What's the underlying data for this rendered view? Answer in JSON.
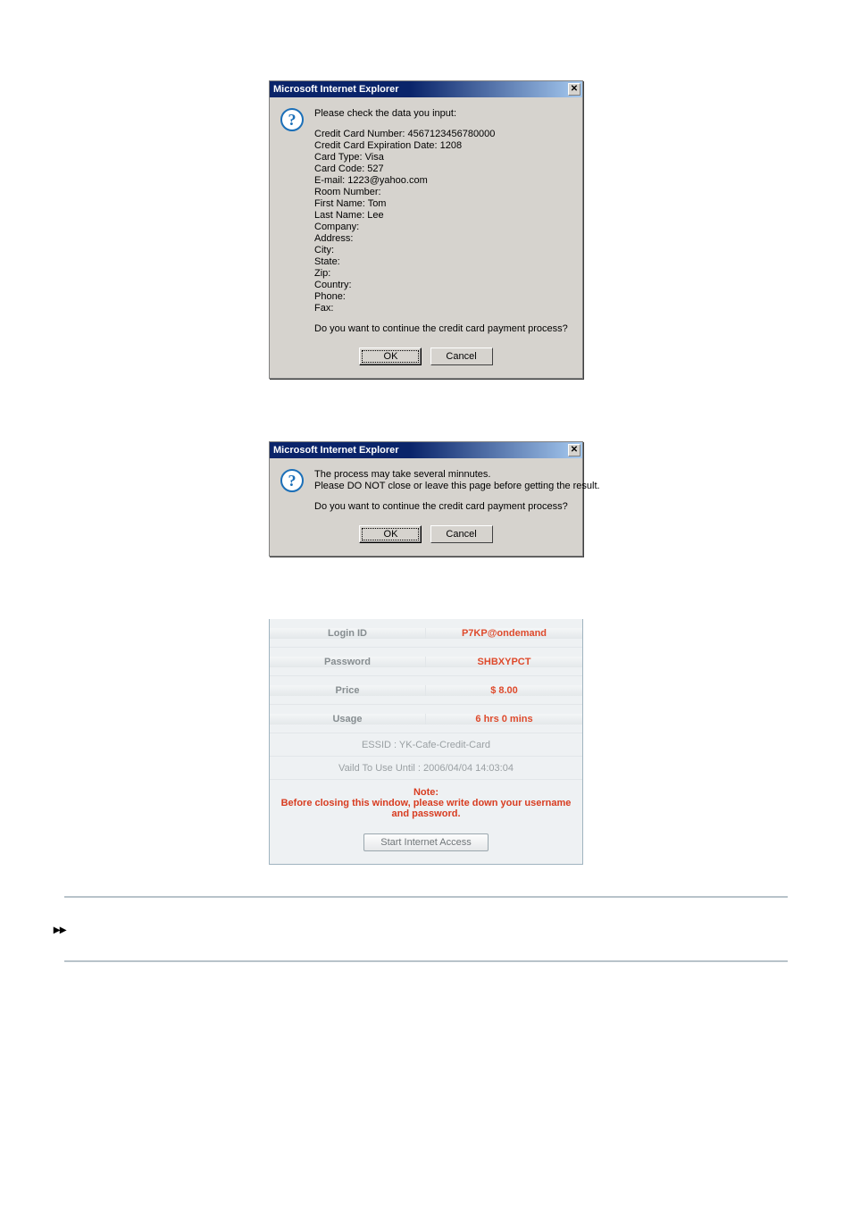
{
  "dialog1": {
    "title": "Microsoft Internet Explorer",
    "close": "✕",
    "intro": "Please check the data you input:",
    "fields": [
      "Credit Card Number: 4567123456780000",
      "Credit Card Expiration Date: 1208",
      "Card Type: Visa",
      "Card Code: 527",
      "E-mail: 1223@yahoo.com",
      "Room Number:",
      "First Name: Tom",
      "Last Name: Lee",
      "Company:",
      "Address:",
      "City:",
      "State:",
      "Zip:",
      "Country:",
      "Phone:",
      "Fax:"
    ],
    "prompt": "Do you want to continue the credit card payment process?",
    "ok": "OK",
    "cancel": "Cancel"
  },
  "dialog2": {
    "title": "Microsoft Internet Explorer",
    "close": "✕",
    "line1": "The process may take several minnutes.",
    "line2": "Please DO NOT close or leave this page before getting the result.",
    "prompt": "Do you want to continue the credit card payment process?",
    "ok": "OK",
    "cancel": "Cancel"
  },
  "info": {
    "login_id_label": "Login ID",
    "login_id_value": "P7KP@ondemand",
    "password_label": "Password",
    "password_value": "SHBXYPCT",
    "price_label": "Price",
    "price_value": "$ 8.00",
    "usage_label": "Usage",
    "usage_value": "6 hrs 0 mins",
    "essid": "ESSID : YK-Cafe-Credit-Card",
    "valid": "Vaild To Use Until : 2006/04/04 14:03:04",
    "note_label": "Note:",
    "note_text": "Before closing this window, please write down your username and password.",
    "start_button": "Start Internet Access"
  },
  "chevron": "▸▸"
}
